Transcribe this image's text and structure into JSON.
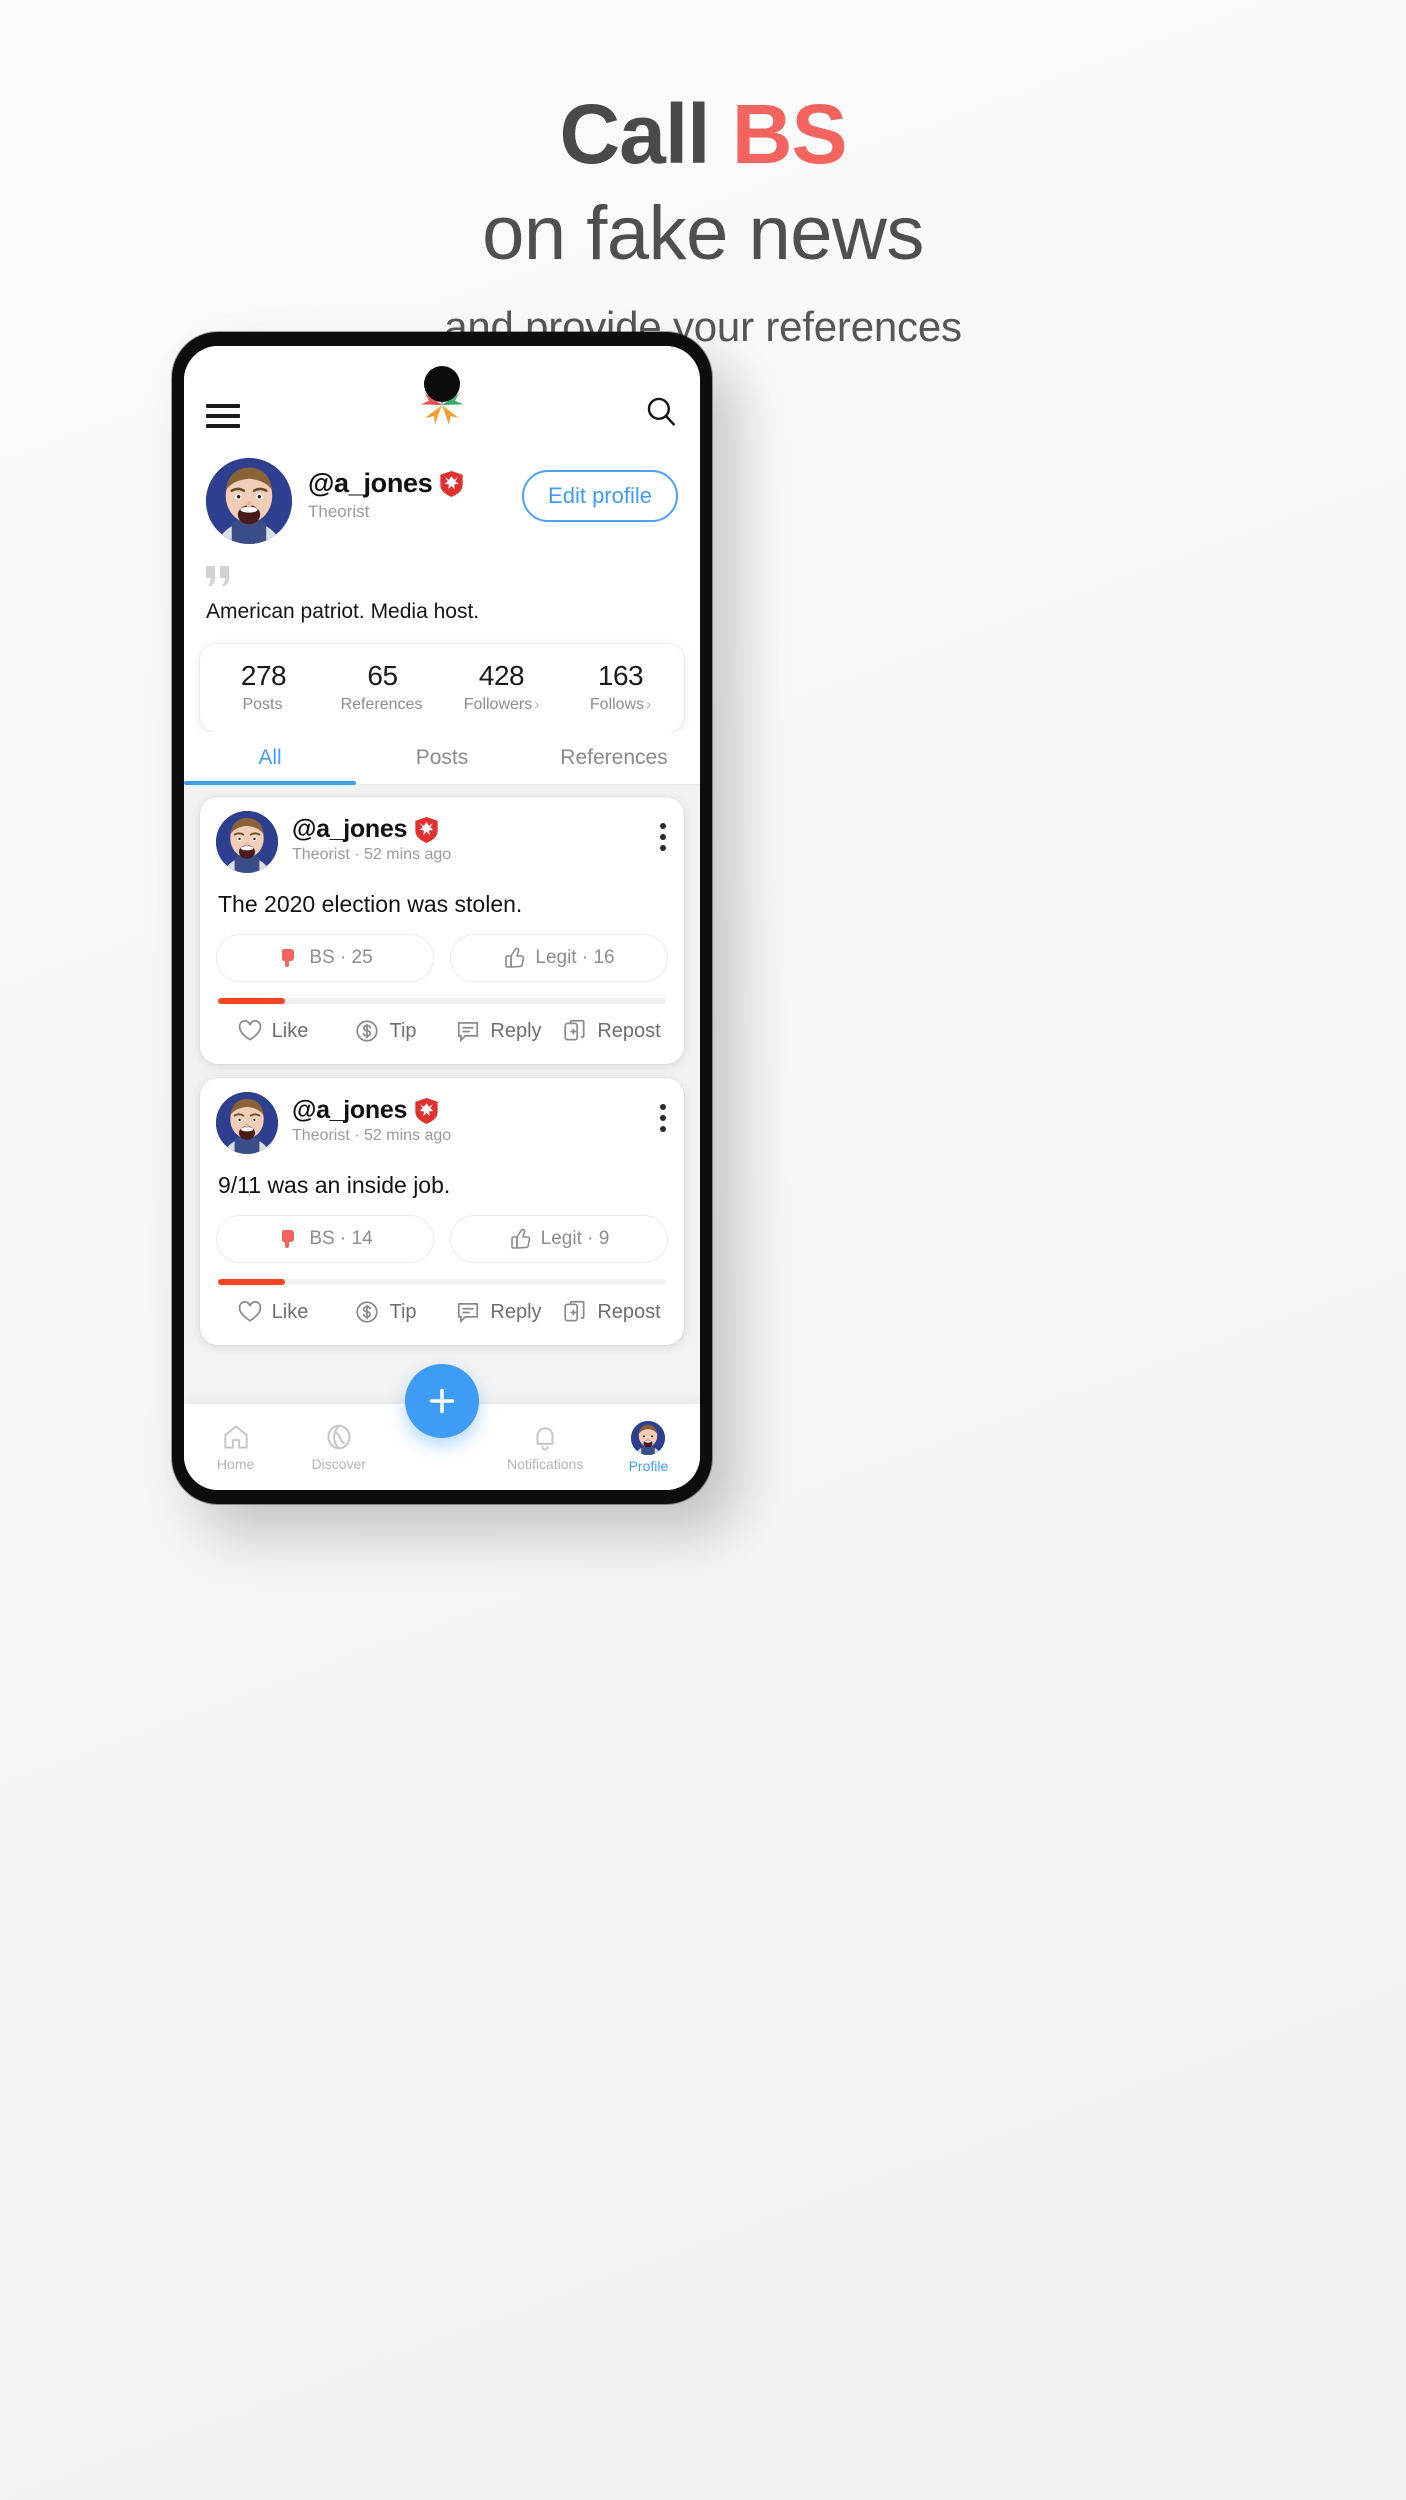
{
  "promo": {
    "line1_a": "Call ",
    "line1_b": "BS",
    "line2": "on fake news",
    "line3": "and provide your references",
    "accent_color": "#f4645f",
    "text_color": "#4a4a4a"
  },
  "appbar": {
    "menu_icon": "hamburger-menu-icon",
    "logo_icon": "app-logo-star-icon",
    "search_icon": "search-icon"
  },
  "profile": {
    "handle": "@a_jones",
    "badge_icon": "verified-shield-icon",
    "role": "Theorist",
    "edit_button": "Edit profile",
    "quote_icon": "quote-mark-icon",
    "bio": "American patriot. Media host.",
    "avatar_icon": "user-avatar",
    "stats": [
      {
        "value": "278",
        "label": "Posts",
        "chevron": ""
      },
      {
        "value": "65",
        "label": "References",
        "chevron": ""
      },
      {
        "value": "428",
        "label": "Followers",
        "chevron": "›"
      },
      {
        "value": "163",
        "label": "Follows",
        "chevron": "›"
      }
    ]
  },
  "tabs": [
    {
      "label": "All",
      "active": true
    },
    {
      "label": "Posts",
      "active": false
    },
    {
      "label": "References",
      "active": false
    }
  ],
  "feed": [
    {
      "handle": "@a_jones",
      "meta": "Theorist · 52 mins ago",
      "text": "The 2020 election was stolen.",
      "bs_label": "BS · 25",
      "legit_label": "Legit · 16",
      "meter_percent": 15,
      "meter_color": "#f4441f",
      "actions": [
        {
          "label": "Like",
          "icon": "heart-icon"
        },
        {
          "label": "Tip",
          "icon": "dollar-circle-icon"
        },
        {
          "label": "Reply",
          "icon": "speech-bubble-icon"
        },
        {
          "label": "Repost",
          "icon": "repost-icon"
        }
      ]
    },
    {
      "handle": "@a_jones",
      "meta": "Theorist · 52 mins ago",
      "text": "9/11 was an inside job.",
      "bs_label": "BS · 14",
      "legit_label": "Legit · 9",
      "meter_percent": 15,
      "meter_color": "#f4441f",
      "actions": [
        {
          "label": "Like",
          "icon": "heart-icon"
        },
        {
          "label": "Tip",
          "icon": "dollar-circle-icon"
        },
        {
          "label": "Reply",
          "icon": "speech-bubble-icon"
        },
        {
          "label": "Repost",
          "icon": "repost-icon"
        }
      ]
    }
  ],
  "fab": {
    "icon": "plus-icon"
  },
  "bottom_nav": [
    {
      "label": "Home",
      "icon": "home-icon",
      "active": false
    },
    {
      "label": "Discover",
      "icon": "globe-icon",
      "active": false
    },
    {
      "label": "Notifications",
      "icon": "bell-icon",
      "active": false
    },
    {
      "label": "Profile",
      "icon": "profile-avatar-icon",
      "active": true
    }
  ],
  "colors": {
    "accent_blue": "#3f9cf5",
    "bs_red": "#f4645f",
    "meter_red": "#f4441f",
    "badge_red": "#e03131"
  }
}
